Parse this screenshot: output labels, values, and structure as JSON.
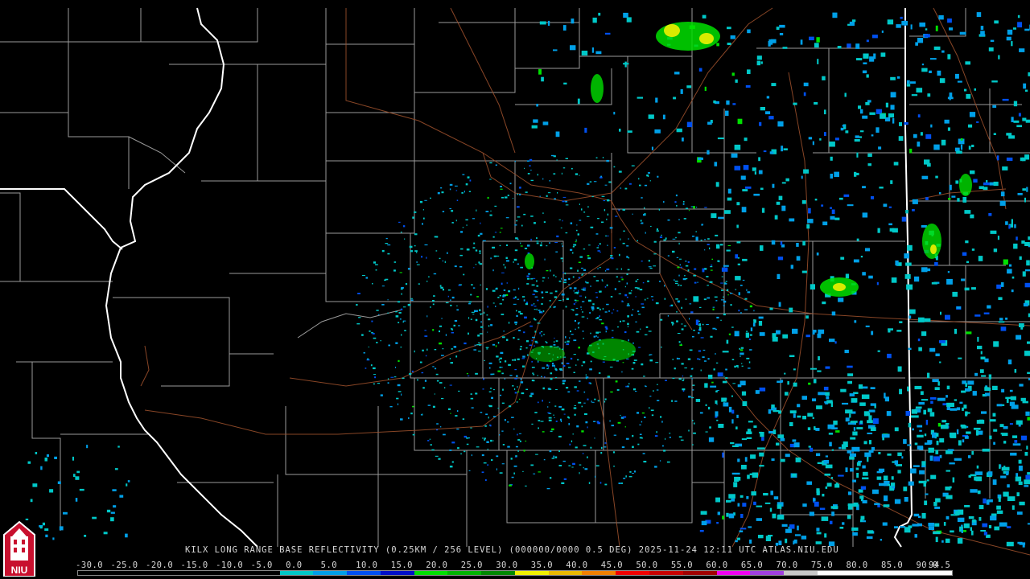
{
  "caption": "KILX LONG RANGE BASE REFLECTIVITY (0.25KM / 256 LEVEL) (000000/0000 0.5 DEG) 2025-11-24 12:11 UTC  ATLAS.NIU.EDU",
  "logo_text": "NIU",
  "scale": {
    "labels": [
      "-30.0",
      "-25.0",
      "-20.0",
      "-15.0",
      "-10.0",
      "-5.0",
      "0.0",
      "5.0",
      "10.0",
      "15.0",
      "20.0",
      "25.0",
      "30.0",
      "35.0",
      "40.0",
      "45.0",
      "50.0",
      "55.0",
      "60.0",
      "65.0",
      "70.0",
      "75.0",
      "80.0",
      "85.0",
      "90.0",
      "94.5"
    ],
    "colors": [
      "#000000",
      "#000000",
      "#000000",
      "#000000",
      "#000000",
      "#000000",
      "#00c8c8",
      "#00a0e8",
      "#0050f0",
      "#0010c8",
      "#00e000",
      "#00b400",
      "#008800",
      "#f0f000",
      "#e8b800",
      "#f08000",
      "#f00000",
      "#c80000",
      "#a00000",
      "#f000f0",
      "#a040e0",
      "#c8c8c8",
      "#ffffff",
      "#ffffff",
      "#ffffff",
      "#ffffff"
    ]
  },
  "map": {
    "station": "KILX",
    "echo_colors": [
      "#00c8c8",
      "#00a0e8",
      "#0050f0",
      "#00e000",
      "#f0f000"
    ]
  }
}
